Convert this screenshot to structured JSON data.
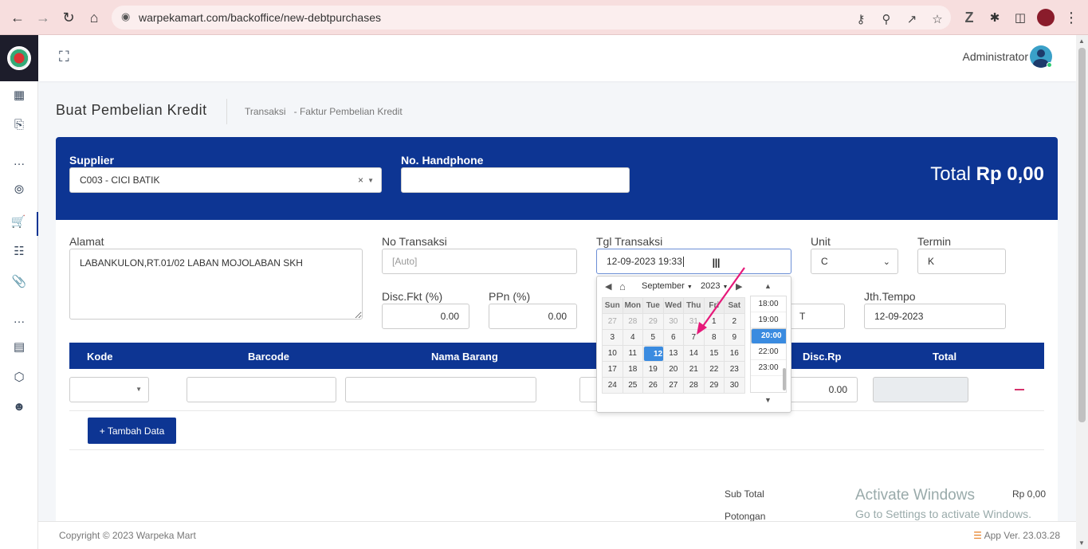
{
  "browser": {
    "url": "warpekamart.com/backoffice/new-debtpurchases"
  },
  "topbar": {
    "user": "Administrator"
  },
  "page": {
    "title": "Buat Pembelian Kredit",
    "breadcrumb": [
      "Transaksi",
      "-",
      "Faktur Pembelian Kredit"
    ]
  },
  "banner": {
    "supplier_label": "Supplier",
    "supplier_value": "C003 - CICI BATIK",
    "phone_label": "No. Handphone",
    "phone_value": "",
    "total_label": "Total",
    "total_value": "Rp 0,00"
  },
  "form": {
    "alamat_label": "Alamat",
    "alamat_value": "LABANKULON,RT.01/02 LABAN MOJOLABAN SKH",
    "no_transaksi_label": "No Transaksi",
    "no_transaksi_placeholder": "[Auto]",
    "tgl_label": "Tgl Transaksi",
    "tgl_value": "12-09-2023 19:33",
    "unit_label": "Unit",
    "unit_value": "C",
    "termin_label": "Termin",
    "termin_value": "K",
    "disc_label": "Disc.Fkt (%)",
    "disc_value": "0.00",
    "ppn_label": "PPn (%)",
    "ppn_value": "0.00",
    "hidden_field_value": "T",
    "jth_label": "Jth.Tempo",
    "jth_value": "12-09-2023"
  },
  "table": {
    "headers": [
      "Kode",
      "Barcode",
      "Nama Barang",
      "Disc.Rp",
      "Total"
    ],
    "row": {
      "disc_rp": "0.00"
    }
  },
  "buttons": {
    "add": "+ Tambah Data"
  },
  "summary": {
    "subtotal_label": "Sub Total",
    "subtotal_value": "Rp 0,00",
    "potongan_label": "Potongan"
  },
  "watermark": {
    "line1": "Activate Windows",
    "line2": "Go to Settings to activate Windows."
  },
  "footer": {
    "copyright": "Copyright © 2023 Warpeka Mart",
    "version": "App Ver. 23.03.28"
  },
  "datepicker": {
    "month": "September",
    "year": "2023",
    "weekdays": [
      "Sun",
      "Mon",
      "Tue",
      "Wed",
      "Thu",
      "Fri",
      "Sat"
    ],
    "weeks": [
      [
        "27",
        "28",
        "29",
        "30",
        "31",
        "1",
        "2"
      ],
      [
        "3",
        "4",
        "5",
        "6",
        "7",
        "8",
        "9"
      ],
      [
        "10",
        "11",
        "12",
        "13",
        "14",
        "15",
        "16"
      ],
      [
        "17",
        "18",
        "19",
        "20",
        "21",
        "22",
        "23"
      ],
      [
        "24",
        "25",
        "26",
        "27",
        "28",
        "29",
        "30"
      ]
    ],
    "selected_day": "12",
    "times": [
      "18:00",
      "19:00",
      "20:00",
      "21:00",
      "22:00",
      "23:00"
    ],
    "selected_time": "20:00"
  },
  "colors": {
    "primary": "#0d3593",
    "accent_arrow": "#e6197a",
    "selected": "#3a8be0"
  }
}
